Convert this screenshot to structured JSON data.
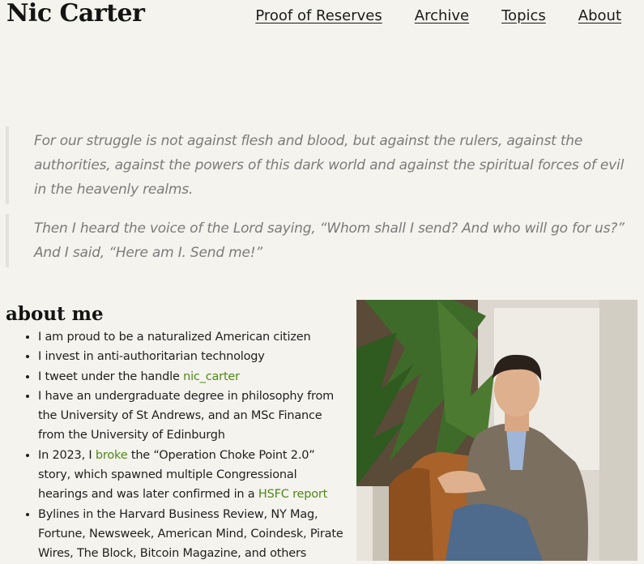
{
  "site": {
    "title": "Nic Carter"
  },
  "nav": {
    "items": [
      "Proof of Reserves",
      "Archive",
      "Topics",
      "About"
    ]
  },
  "quotes": [
    "For our struggle is not against flesh and blood, but against the rulers, against the authorities, against the powers of this dark world and against the spiritual forces of evil in the heavenly realms.",
    "Then I heard the voice of the Lord saying, “Whom shall I send? And who will go for us?” And I said, “Here am I. Send me!”"
  ],
  "about": {
    "heading": "about me",
    "items": {
      "citizen": "I am proud to be a naturalized American citizen",
      "invest": "I invest in anti-authoritarian technology",
      "tweet_prefix": "I tweet under the handle ",
      "tweet_handle": "nic_carter",
      "degree": "I have an undergraduate degree in philosophy from the University of St Andrews, and an MSc Finance from the University of Edinburgh",
      "choke_prefix": "In 2023, I ",
      "choke_link": "broke",
      "choke_middle": " the “Operation Choke Point 2.0” story, which spawned multiple Congressional hearings and was later confirmed in a ",
      "choke_report": "HSFC report",
      "bylines": "Bylines in the Harvard Business Review, NY Mag, Fortune, Newsweek, American Mind, Coindesk, Pirate Wires, The Block, Bitcoin Magazine, and others"
    }
  },
  "colors": {
    "background": "#f5f3ee",
    "link": "#4d8a17",
    "quote_text": "#7b7b7b"
  },
  "photo": {
    "icon": "portrait-photo"
  }
}
